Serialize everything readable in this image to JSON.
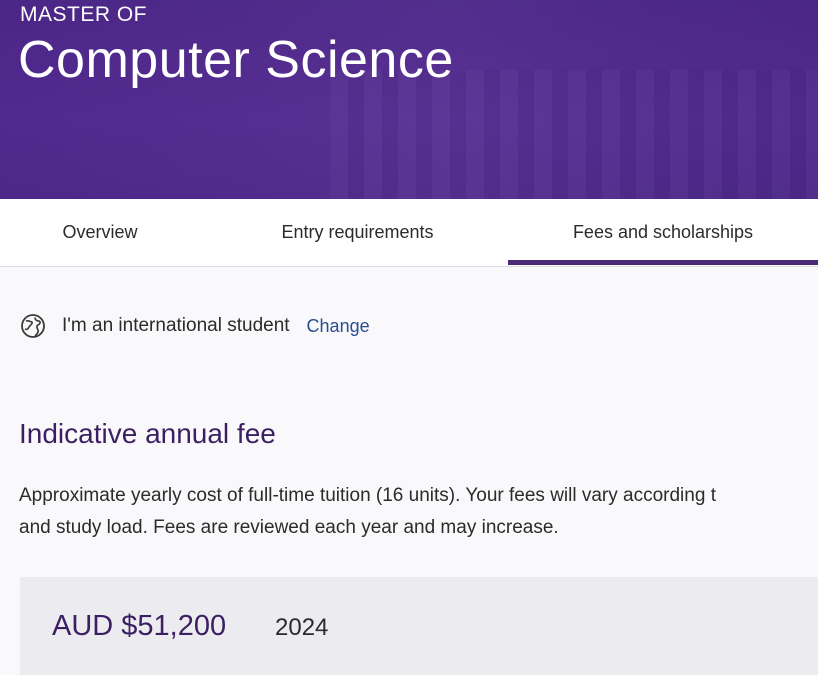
{
  "hero": {
    "eyebrow": "MASTER OF",
    "title": "Computer Science"
  },
  "tabs": [
    {
      "label": "Overview",
      "active": false
    },
    {
      "label": "Entry requirements",
      "active": false
    },
    {
      "label": "Fees and scholarships",
      "active": true
    }
  ],
  "student_type": {
    "icon": "globe-icon",
    "label": "I'm an international student",
    "change_label": "Change"
  },
  "fee_section": {
    "heading": "Indicative annual fee",
    "description_line1": "Approximate yearly cost of full-time tuition (16 units). Your fees will vary according t",
    "description_line2": "and study load. Fees are reviewed each year and may increase.",
    "amount": "AUD $51,200",
    "year": "2024"
  },
  "colors": {
    "brand_purple": "#4f2a8a",
    "heading_purple": "#3c1f63",
    "link_blue": "#2a4d8f"
  }
}
